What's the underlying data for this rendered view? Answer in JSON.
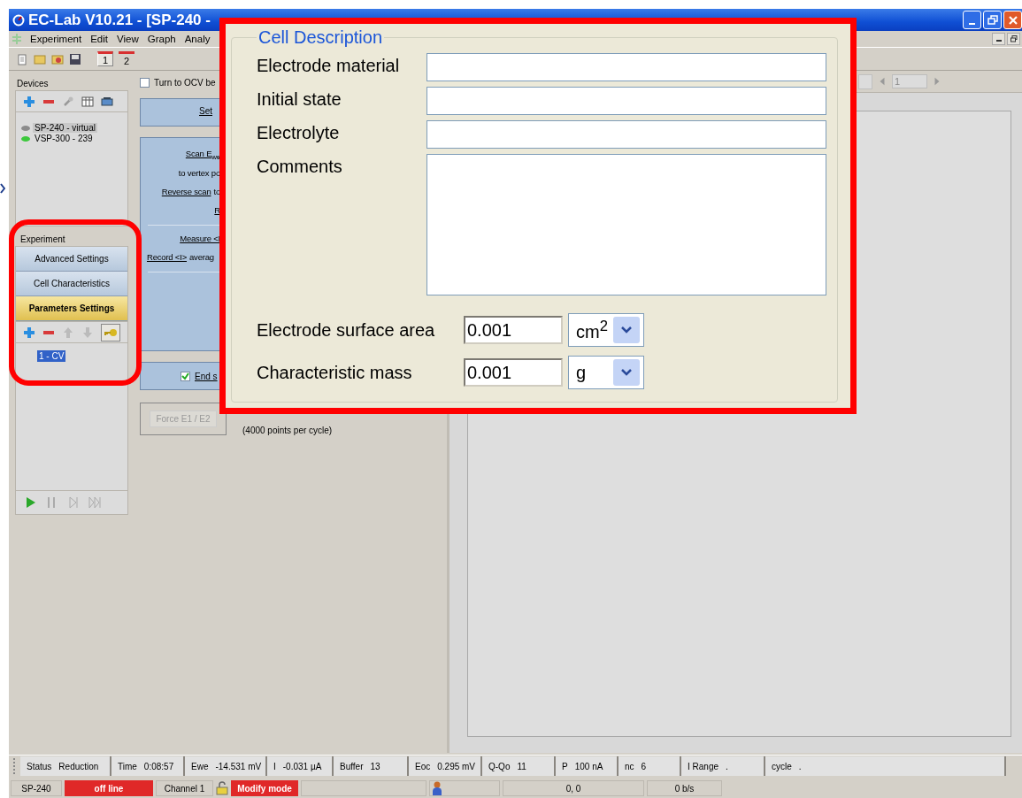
{
  "window": {
    "title": "EC-Lab V10.21 - [SP-240 -"
  },
  "menu": [
    "Experiment",
    "Edit",
    "View",
    "Graph",
    "Analy"
  ],
  "toolbar": {
    "tabs": [
      {
        "label": "1",
        "selected": true
      },
      {
        "label": "2",
        "selected": false
      }
    ]
  },
  "devices": {
    "title": "Devices",
    "items": [
      {
        "label": "SP-240 - virtual",
        "color": "#8c8c8c",
        "selected": true
      },
      {
        "label": "VSP-300 - 239",
        "color": "#3cc83c",
        "selected": false
      }
    ]
  },
  "experiment": {
    "title": "Experiment",
    "buttons": [
      {
        "label": "Advanced Settings",
        "selected": false
      },
      {
        "label": "Cell Characteristics",
        "selected": false
      },
      {
        "label": "Parameters Settings",
        "selected": true
      }
    ],
    "items": [
      {
        "label": "1 - CV",
        "selected": true
      }
    ]
  },
  "parameters": {
    "ocv_checkbox": {
      "label": "Turn to OCV be",
      "checked": false
    },
    "set_link": "Set",
    "lines": [
      {
        "link": "Scan E$_{we}$"
      },
      {
        "text": "to vertex po"
      },
      {
        "link": "Reverse scan",
        "text": "to"
      },
      {
        "link": "R"
      },
      {
        "link": "Measure <I"
      },
      {
        "link": "Record <I>",
        "text": "averag"
      }
    ],
    "end_checkbox": {
      "label": "End s",
      "checked": true
    },
    "force_button": "Force E1 / E2",
    "note": "(4000 points per cycle)"
  },
  "graph_toolbar": {
    "page": "1"
  },
  "cell_description": {
    "title": "Cell Description",
    "fields": [
      {
        "label": "Electrode material",
        "kind": "text"
      },
      {
        "label": "Initial state",
        "kind": "text"
      },
      {
        "label": "Electrolyte",
        "kind": "text"
      },
      {
        "label": "Comments",
        "kind": "textarea"
      },
      {
        "label": "Electrode surface area",
        "kind": "unit",
        "value": "0.001",
        "unit": "cm$^{2}$"
      },
      {
        "label": "Characteristic mass",
        "kind": "unit",
        "value": "0.001",
        "unit": "g"
      }
    ]
  },
  "status_bar": [
    {
      "label": "Status",
      "value": "Reduction"
    },
    {
      "label": "Time",
      "value": "0:08:57"
    },
    {
      "label": "Ewe",
      "value": "-14.531 mV"
    },
    {
      "label": "I",
      "value": "-0.031 µA"
    },
    {
      "label": "Buffer",
      "value": "13"
    },
    {
      "label": "Eoc",
      "value": "0.295 mV"
    },
    {
      "label": "Q-Qo",
      "value": "11"
    },
    {
      "label": "P",
      "value": "100 nA"
    },
    {
      "label": "nc",
      "value": "6"
    },
    {
      "label": "I Range",
      "value": "."
    },
    {
      "label": "cycle",
      "value": "."
    }
  ],
  "bottom_bar": [
    {
      "kind": "text",
      "text": "SP-240"
    },
    {
      "kind": "alert",
      "text": "off line"
    },
    {
      "kind": "text",
      "text": "Channel 1"
    },
    {
      "kind": "lock"
    },
    {
      "kind": "alert",
      "text": "Modify mode"
    },
    {
      "kind": "empty"
    },
    {
      "kind": "user"
    },
    {
      "kind": "text",
      "text": "0, 0"
    },
    {
      "kind": "text",
      "text": "0 b/s"
    }
  ]
}
